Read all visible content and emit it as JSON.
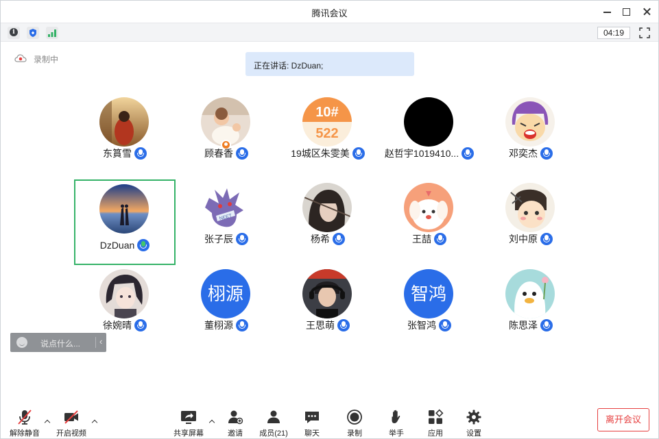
{
  "window": {
    "title": "腾讯会议"
  },
  "infobar": {
    "timer": "04:19"
  },
  "recording": {
    "label": "录制中"
  },
  "speaking": {
    "text": "正在讲话: DzDuan;"
  },
  "participants": [
    {
      "name": "东篔雪",
      "mic": "muted"
    },
    {
      "name": "顾春香",
      "mic": "muted",
      "host": true
    },
    {
      "name": "19城区朱雯美",
      "mic": "muted"
    },
    {
      "name": "赵哲宇1019410...",
      "mic": "muted"
    },
    {
      "name": "邓奕杰",
      "mic": "muted"
    },
    {
      "name": "DzDuan",
      "mic": "speaking",
      "active": true
    },
    {
      "name": "张子辰",
      "mic": "muted"
    },
    {
      "name": "杨希",
      "mic": "muted"
    },
    {
      "name": "王喆",
      "mic": "muted"
    },
    {
      "name": "刘中原",
      "mic": "muted"
    },
    {
      "name": "徐婉晴",
      "mic": "muted"
    },
    {
      "name": "董栩源",
      "mic": "muted",
      "avatar_text": "栩源"
    },
    {
      "name": "王思萌",
      "mic": "muted"
    },
    {
      "name": "张智鸿",
      "mic": "muted",
      "avatar_text": "智鸿"
    },
    {
      "name": "陈思泽",
      "mic": "muted"
    }
  ],
  "chat": {
    "placeholder": "说点什么..."
  },
  "toolbar": {
    "unmute": "解除静音",
    "start_video": "开启视频",
    "share_screen": "共享屏幕",
    "invite": "邀请",
    "members": "成员(21)",
    "chat": "聊天",
    "record": "录制",
    "raise_hand": "举手",
    "apps": "应用",
    "settings": "设置",
    "leave": "离开会议"
  },
  "colors": {
    "accent": "#2a6de8",
    "active_border": "#34b267",
    "leave": "#e63f3f",
    "speaking_bg": "#dce9fb"
  }
}
